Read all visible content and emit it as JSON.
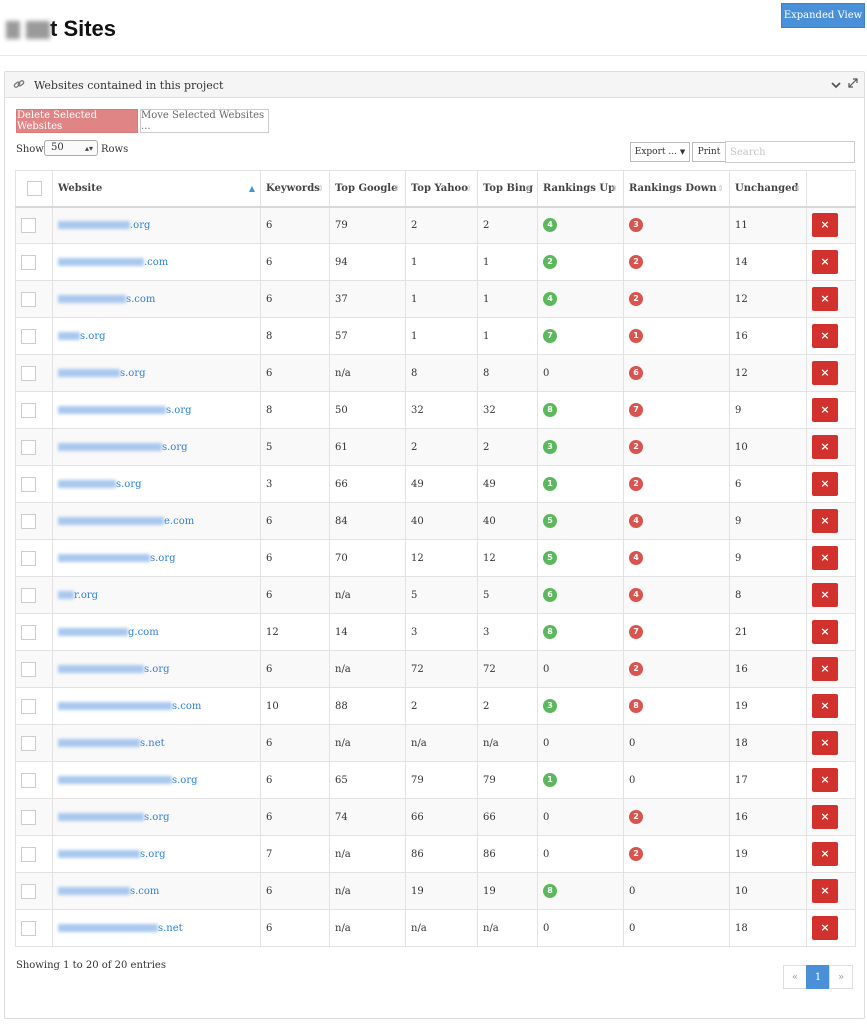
{
  "header": {
    "title_suffix": "t Sites",
    "expanded_view_label": "Expanded View"
  },
  "panel": {
    "title": "Websites contained in this project"
  },
  "toolbar": {
    "delete_label": "Delete Selected Websites",
    "move_label": "Move Selected Websites ...",
    "show_label": "Show",
    "rows_value": "50",
    "rows_label": "Rows",
    "export_label": "Export ...",
    "print_label": "Print",
    "search_placeholder": "Search"
  },
  "table": {
    "columns": [
      "Website",
      "Keywords",
      "Top Google",
      "Top Yahoo",
      "Top Bing",
      "Rankings Up",
      "Rankings Down",
      "Unchanged"
    ],
    "rows": [
      {
        "site_suffix": ".org",
        "keywords": "6",
        "google": "79",
        "yahoo": "2",
        "bing": "2",
        "up": "4",
        "down": "3",
        "unchanged": "11"
      },
      {
        "site_suffix": ".com",
        "keywords": "6",
        "google": "94",
        "yahoo": "1",
        "bing": "1",
        "up": "2",
        "down": "2",
        "unchanged": "14"
      },
      {
        "site_suffix": "s.com",
        "keywords": "6",
        "google": "37",
        "yahoo": "1",
        "bing": "1",
        "up": "4",
        "down": "2",
        "unchanged": "12"
      },
      {
        "site_suffix": "s.org",
        "keywords": "8",
        "google": "57",
        "yahoo": "1",
        "bing": "1",
        "up": "7",
        "down": "1",
        "unchanged": "16"
      },
      {
        "site_suffix": "s.org",
        "keywords": "6",
        "google": "n/a",
        "yahoo": "8",
        "bing": "8",
        "up": "0",
        "down": "6",
        "unchanged": "12"
      },
      {
        "site_suffix": "s.org",
        "keywords": "8",
        "google": "50",
        "yahoo": "32",
        "bing": "32",
        "up": "8",
        "down": "7",
        "unchanged": "9"
      },
      {
        "site_suffix": "s.org",
        "keywords": "5",
        "google": "61",
        "yahoo": "2",
        "bing": "2",
        "up": "3",
        "down": "2",
        "unchanged": "10"
      },
      {
        "site_suffix": "s.org",
        "keywords": "3",
        "google": "66",
        "yahoo": "49",
        "bing": "49",
        "up": "1",
        "down": "2",
        "unchanged": "6"
      },
      {
        "site_suffix": "e.com",
        "keywords": "6",
        "google": "84",
        "yahoo": "40",
        "bing": "40",
        "up": "5",
        "down": "4",
        "unchanged": "9"
      },
      {
        "site_suffix": "s.org",
        "keywords": "6",
        "google": "70",
        "yahoo": "12",
        "bing": "12",
        "up": "5",
        "down": "4",
        "unchanged": "9"
      },
      {
        "site_suffix": "r.org",
        "keywords": "6",
        "google": "n/a",
        "yahoo": "5",
        "bing": "5",
        "up": "6",
        "down": "4",
        "unchanged": "8"
      },
      {
        "site_suffix": "g.com",
        "keywords": "12",
        "google": "14",
        "yahoo": "3",
        "bing": "3",
        "up": "8",
        "down": "7",
        "unchanged": "21"
      },
      {
        "site_suffix": "s.org",
        "keywords": "6",
        "google": "n/a",
        "yahoo": "72",
        "bing": "72",
        "up": "0",
        "down": "2",
        "unchanged": "16"
      },
      {
        "site_suffix": "s.com",
        "keywords": "10",
        "google": "88",
        "yahoo": "2",
        "bing": "2",
        "up": "3",
        "down": "8",
        "unchanged": "19"
      },
      {
        "site_suffix": "s.net",
        "keywords": "6",
        "google": "n/a",
        "yahoo": "n/a",
        "bing": "n/a",
        "up": "0",
        "down": "0",
        "unchanged": "18"
      },
      {
        "site_suffix": "s.org",
        "keywords": "6",
        "google": "65",
        "yahoo": "79",
        "bing": "79",
        "up": "1",
        "down": "0",
        "unchanged": "17"
      },
      {
        "site_suffix": "s.org",
        "keywords": "6",
        "google": "74",
        "yahoo": "66",
        "bing": "66",
        "up": "0",
        "down": "2",
        "unchanged": "16"
      },
      {
        "site_suffix": "s.org",
        "keywords": "7",
        "google": "n/a",
        "yahoo": "86",
        "bing": "86",
        "up": "0",
        "down": "2",
        "unchanged": "19"
      },
      {
        "site_suffix": "s.com",
        "keywords": "6",
        "google": "n/a",
        "yahoo": "19",
        "bing": "19",
        "up": "8",
        "down": "0",
        "unchanged": "10"
      },
      {
        "site_suffix": "s.net",
        "keywords": "6",
        "google": "n/a",
        "yahoo": "n/a",
        "bing": "n/a",
        "up": "0",
        "down": "0",
        "unchanged": "18"
      }
    ]
  },
  "footer": {
    "info": "Showing 1 to 20 of 20 entries",
    "prev": "«",
    "page": "1",
    "next": "»"
  },
  "icons": {
    "delete_row": "×"
  },
  "colors": {
    "accent": "#4a90d9",
    "danger": "#d2322d",
    "up_badge": "#5cb85c",
    "down_badge": "#d9534f",
    "link": "#2f7fd1"
  }
}
